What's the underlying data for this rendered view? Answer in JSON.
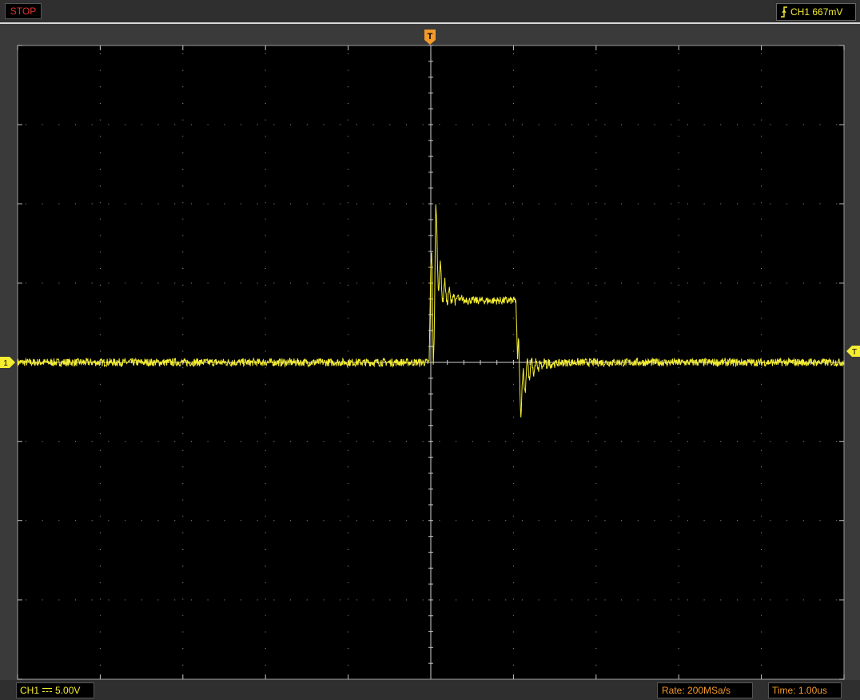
{
  "status": {
    "label": "STOP",
    "color": "#e8322f"
  },
  "trigger": {
    "icon": "rising-edge-icon",
    "label": "CH1 667mV",
    "marker_letter": "T",
    "marker_color": "#f29a2a"
  },
  "channel": {
    "marker_label": "1",
    "name": "CH1",
    "coupling_icon": "dc-coupling-icon",
    "volts_per_div": "5.00V",
    "color": "#f5ee30"
  },
  "acquisition": {
    "rate": "Rate: 200MSa/s",
    "time": "Time: 1.00us"
  },
  "colors": {
    "grid": "#c8c8c8",
    "background": "#000000",
    "trace": "#f5ee30",
    "accent": "#f29a2a"
  },
  "chart_data": {
    "type": "line",
    "title": "",
    "xlabel": "",
    "ylabel": "",
    "divisions": {
      "x": 10,
      "y": 8
    },
    "x_unit": "us",
    "y_unit": "V",
    "xlim": [
      -5.0,
      5.0
    ],
    "ylim": [
      -20.0,
      20.0
    ],
    "series": [
      {
        "values_description": "",
        "x": [
          -5.0,
          -0.02,
          0.0,
          0.03,
          0.06,
          0.09,
          0.12,
          0.15,
          0.2,
          0.3,
          0.5,
          0.8,
          1.03,
          1.05,
          1.08,
          1.11,
          1.14,
          1.18,
          1.25,
          1.4,
          1.7,
          2.2,
          5.0
        ],
        "y": [
          0.0,
          0.0,
          6.0,
          1.0,
          8.5,
          6.0,
          5.0,
          4.6,
          4.2,
          4.0,
          3.9,
          3.9,
          3.9,
          0.0,
          -1.5,
          -2.0,
          -0.8,
          -0.5,
          -0.3,
          -0.1,
          0.0,
          0.0,
          0.0
        ]
      }
    ]
  }
}
